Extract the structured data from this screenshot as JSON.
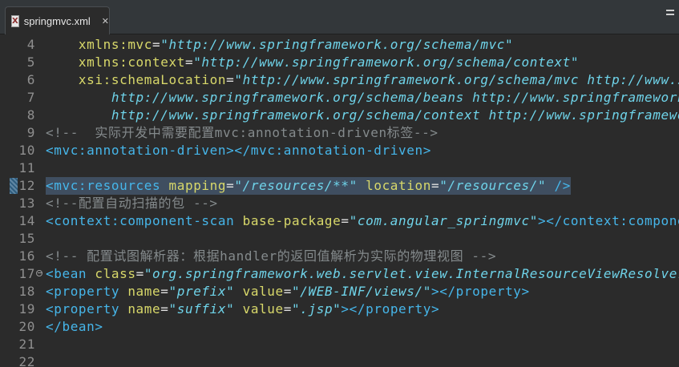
{
  "tab": {
    "title": "springmvc.xml",
    "close": "✕",
    "icon_glyph": "X"
  },
  "editor": {
    "lines": [
      {
        "num": "4",
        "tokens": [
          {
            "t": "    xmlns:mvc",
            "c": "attr"
          },
          {
            "t": "=",
            "c": "eq"
          },
          {
            "t": "\"http://www.springframework.org/schema/mvc\"",
            "c": "val"
          }
        ]
      },
      {
        "num": "5",
        "tokens": [
          {
            "t": "    xmlns:context",
            "c": "attr"
          },
          {
            "t": "=",
            "c": "eq"
          },
          {
            "t": "\"http://www.springframework.org/schema/context\"",
            "c": "val"
          }
        ]
      },
      {
        "num": "6",
        "tokens": [
          {
            "t": "    xsi:schemaLocation",
            "c": "attr"
          },
          {
            "t": "=",
            "c": "eq"
          },
          {
            "t": "\"http://www.springframework.org/schema/mvc http://www.sp",
            "c": "val"
          }
        ]
      },
      {
        "num": "7",
        "tokens": [
          {
            "t": "        http://www.springframework.org/schema/beans http://www.springframework.",
            "c": "val"
          }
        ]
      },
      {
        "num": "8",
        "tokens": [
          {
            "t": "        http://www.springframework.org/schema/context http://www.springframewor",
            "c": "val"
          }
        ]
      },
      {
        "num": "9",
        "tokens": [
          {
            "t": "<!--  实际开发中需要配置mvc:annotation-driven标签-->",
            "c": "com"
          }
        ]
      },
      {
        "num": "10",
        "tokens": [
          {
            "t": "<mvc:annotation-driven></mvc:annotation-driven>",
            "c": "tag"
          }
        ]
      },
      {
        "num": "11",
        "tokens": []
      },
      {
        "num": "12",
        "highlight": true,
        "tokens": [
          {
            "t": "<mvc:resources ",
            "c": "tag"
          },
          {
            "t": "mapping",
            "c": "attr"
          },
          {
            "t": "=",
            "c": "eq"
          },
          {
            "t": "\"/resources/**\"",
            "c": "val"
          },
          {
            "t": " location",
            "c": "attr"
          },
          {
            "t": "=",
            "c": "eq"
          },
          {
            "t": "\"/resources/\"",
            "c": "val"
          },
          {
            "t": " />",
            "c": "tag"
          }
        ]
      },
      {
        "num": "13",
        "tokens": [
          {
            "t": "<!--配置自动扫描的包 -->",
            "c": "com"
          }
        ]
      },
      {
        "num": "14",
        "tokens": [
          {
            "t": "<context:component-scan ",
            "c": "tag"
          },
          {
            "t": "base-package",
            "c": "attr"
          },
          {
            "t": "=",
            "c": "eq"
          },
          {
            "t": "\"com.angular_springmvc\"",
            "c": "val"
          },
          {
            "t": "></context:component",
            "c": "tag"
          }
        ]
      },
      {
        "num": "15",
        "tokens": []
      },
      {
        "num": "16",
        "tokens": [
          {
            "t": "<!-- 配置试图解析器：根据handler的返回值解析为实际的物理视图 -->",
            "c": "com"
          }
        ]
      },
      {
        "num": "17",
        "fold": true,
        "tokens": [
          {
            "t": "<bean ",
            "c": "tag"
          },
          {
            "t": "class",
            "c": "attr"
          },
          {
            "t": "=",
            "c": "eq"
          },
          {
            "t": "\"org.springframework.web.servlet.view.InternalResourceViewResolver\"",
            "c": "val"
          }
        ]
      },
      {
        "num": "18",
        "tokens": [
          {
            "t": "<property ",
            "c": "tag"
          },
          {
            "t": "name",
            "c": "attr"
          },
          {
            "t": "=",
            "c": "eq"
          },
          {
            "t": "\"prefix\"",
            "c": "val"
          },
          {
            "t": " value",
            "c": "attr"
          },
          {
            "t": "=",
            "c": "eq"
          },
          {
            "t": "\"/WEB-INF/views/\"",
            "c": "val"
          },
          {
            "t": "></property>",
            "c": "tag"
          }
        ]
      },
      {
        "num": "19",
        "tokens": [
          {
            "t": "<property ",
            "c": "tag"
          },
          {
            "t": "name",
            "c": "attr"
          },
          {
            "t": "=",
            "c": "eq"
          },
          {
            "t": "\"suffix\"",
            "c": "val"
          },
          {
            "t": " value",
            "c": "attr"
          },
          {
            "t": "=",
            "c": "eq"
          },
          {
            "t": "\".jsp\"",
            "c": "val"
          },
          {
            "t": "></property>",
            "c": "tag"
          }
        ]
      },
      {
        "num": "20",
        "tokens": [
          {
            "t": "</bean>",
            "c": "tag"
          }
        ]
      },
      {
        "num": "21",
        "tokens": []
      },
      {
        "num": "22",
        "tokens": []
      }
    ]
  },
  "colors": {
    "background": "#2b2b2b",
    "tag": "#46b6ea",
    "attribute": "#d8d86a",
    "string": "#6fd4ea",
    "comment": "#848a8c",
    "line_highlight": "#3f4e60"
  }
}
